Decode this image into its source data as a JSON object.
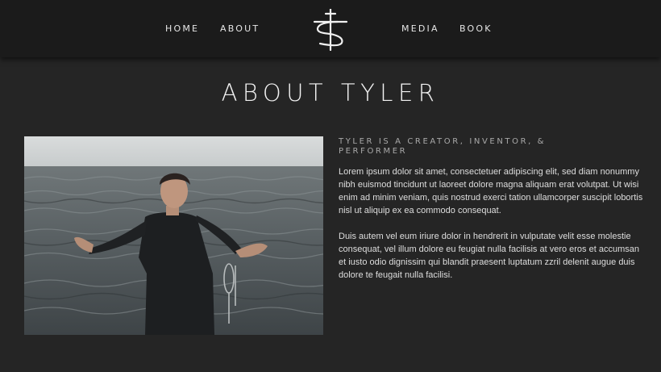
{
  "nav": {
    "home": "HOME",
    "about": "ABOUT",
    "media": "MEDIA",
    "book": "BOOK"
  },
  "logo": {
    "icon": "ts-monogram-icon"
  },
  "page": {
    "title": "ABOUT TYLER"
  },
  "photo": {
    "subject": "man-by-water-photo"
  },
  "bio": {
    "subhead_line1": "TYLER IS A CREATOR, INVENTOR, &",
    "subhead_line2": "PERFORMER",
    "paragraph1": "Lorem ipsum dolor sit amet, consectetuer adipiscing elit, sed diam nonummy nibh euismod tincidunt ut laoreet dolore magna aliquam erat volutpat. Ut wisi enim ad minim veniam, quis nostrud exerci tation ullamcorper suscipit lobortis nisl ut aliquip ex ea commodo consequat.",
    "paragraph2": "Duis autem vel eum iriure dolor in hendrerit in vulputate velit esse molestie consequat, vel illum dolore eu feugiat nulla facilisis at vero eros et accumsan et iusto odio dignissim qui blandit praesent luptatum zzril delenit augue duis dolore te feugait nulla facilisi."
  },
  "colors": {
    "background": "#252525",
    "header": "#1b1b1b",
    "text": "#e8e8e8",
    "subhead": "#a9a9a9"
  }
}
